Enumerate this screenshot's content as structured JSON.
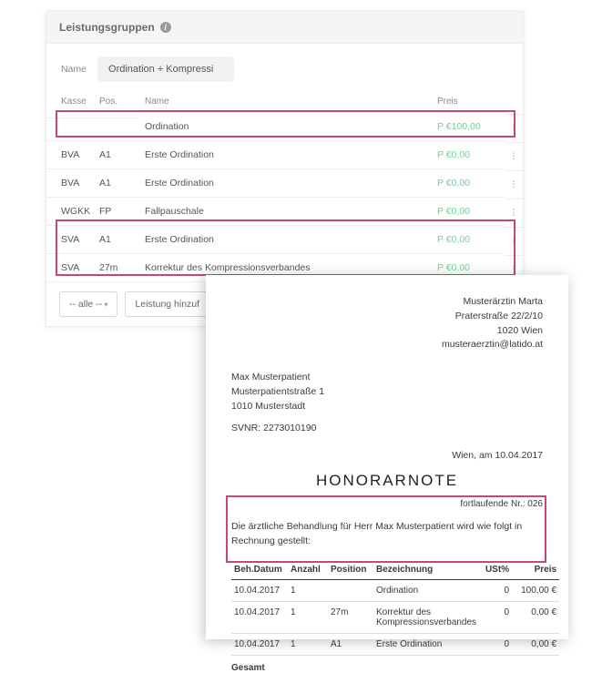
{
  "panel": {
    "title": "Leistungsgruppen",
    "filter_label": "Name",
    "filter_value": "Ordination + Kompressi",
    "headers": {
      "kasse": "Kasse",
      "pos": "Pos.",
      "name": "Name",
      "preis": "Preis"
    },
    "rows": [
      {
        "kasse": "",
        "pos": "",
        "name": "Ordination",
        "preis": "P €100,00"
      },
      {
        "kasse": "BVA",
        "pos": "A1",
        "name": "Erste Ordination",
        "preis": "P €0,00"
      },
      {
        "kasse": "BVA",
        "pos": "A1",
        "name": "Erste Ordination",
        "preis": "P €0,00"
      },
      {
        "kasse": "WGKK",
        "pos": "FP",
        "name": "Fallpauschale",
        "preis": "P €0,00"
      },
      {
        "kasse": "SVA",
        "pos": "A1",
        "name": "Erste Ordination",
        "preis": "P €0,00"
      },
      {
        "kasse": "SVA",
        "pos": "27m",
        "name": "Korrektur des Kompressionsverbandes",
        "preis": "P €0,00"
      }
    ],
    "footer": {
      "dropdown": "-- alle --",
      "add": "Leistung hinzuf"
    }
  },
  "doc": {
    "from": {
      "name": "Musterärztin Marta",
      "street": "Praterstraße 22/2/10",
      "city": "1020 Wien",
      "email": "musteraerztin@latido.at"
    },
    "to": {
      "name": "Max Musterpatient",
      "street": "Musterpatientstraße 1",
      "city": "1010 Musterstadt"
    },
    "svnr_label": "SVNR:",
    "svnr": "2273010190",
    "date": "Wien, am 10.04.2017",
    "title": "HONORARNOTE",
    "run_nr": "fortlaufende Nr.: 026",
    "intro": "Die ärztliche Behandlung für Herr Max Musterpatient wird wie folgt in Rechnung gestellt:",
    "inv_headers": {
      "date": "Beh.Datum",
      "qty": "Anzahl",
      "pos": "Position",
      "desc": "Bezeichnung",
      "ust": "USt%",
      "price": "Preis"
    },
    "inv_rows": [
      {
        "date": "10.04.2017",
        "qty": "1",
        "pos": "",
        "desc": "Ordination",
        "ust": "0",
        "price": "100,00 €"
      },
      {
        "date": "10.04.2017",
        "qty": "1",
        "pos": "27m",
        "desc": "Korrektur des Kompressionsverbandes",
        "ust": "0",
        "price": "0,00 €"
      },
      {
        "date": "10.04.2017",
        "qty": "1",
        "pos": "A1",
        "desc": "Erste Ordination",
        "ust": "0",
        "price": "0,00 €"
      }
    ],
    "total_label": "Gesamt"
  }
}
